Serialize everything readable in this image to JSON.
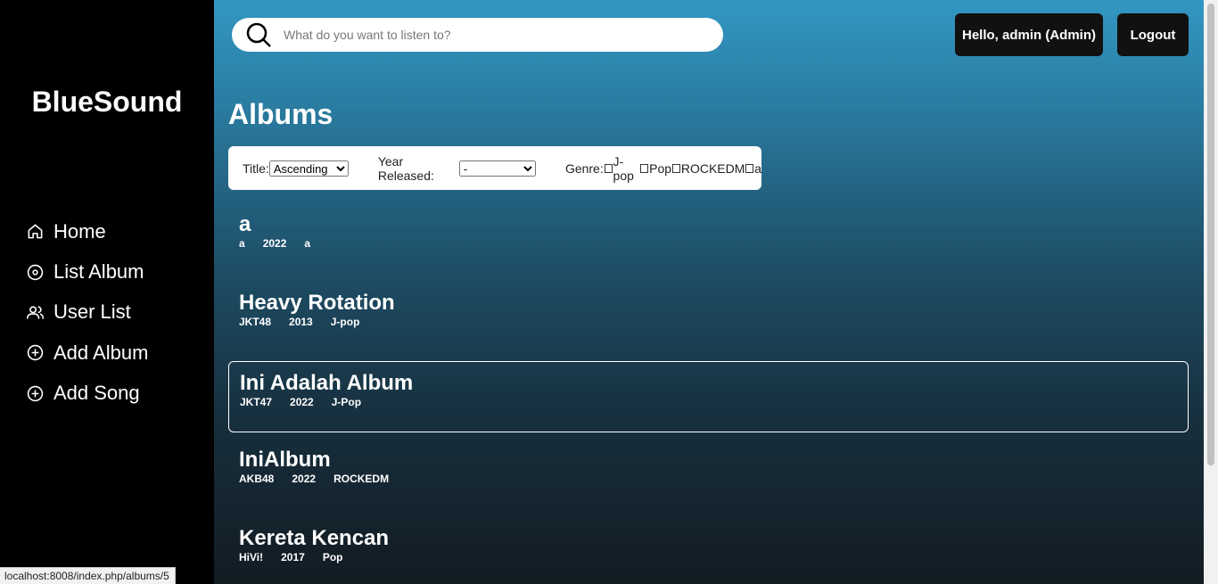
{
  "sidebar": {
    "brand": "BlueSound",
    "items": [
      {
        "label": "Home",
        "icon": "home-icon"
      },
      {
        "label": "List Album",
        "icon": "disc-icon"
      },
      {
        "label": "User List",
        "icon": "users-icon"
      },
      {
        "label": "Add Album",
        "icon": "plus-circle-icon"
      },
      {
        "label": "Add Song",
        "icon": "plus-circle-icon"
      }
    ]
  },
  "header": {
    "search_placeholder": "What do you want to listen to?",
    "greeting": "Hello, admin (Admin)",
    "logout_label": "Logout"
  },
  "main": {
    "title": "Albums",
    "filters": {
      "title_label": "Title:",
      "title_selected": "Ascending",
      "year_label": "Year Released:",
      "year_selected": "-",
      "genre_label": "Genre:",
      "genres": [
        "J-pop",
        "Pop",
        "ROCKEDM",
        "a"
      ]
    },
    "albums": [
      {
        "title": "a",
        "artist": "a",
        "year": "2022",
        "genre": "a"
      },
      {
        "title": "Heavy Rotation",
        "artist": "JKT48",
        "year": "2013",
        "genre": "J-pop"
      },
      {
        "title": "Ini Adalah Album",
        "artist": "JKT47",
        "year": "2022",
        "genre": "J-Pop"
      },
      {
        "title": "IniAlbum",
        "artist": "AKB48",
        "year": "2022",
        "genre": "ROCKEDM"
      },
      {
        "title": "Kereta Kencan",
        "artist": "HiVi!",
        "year": "2017",
        "genre": "Pop"
      }
    ]
  },
  "status_url": "localhost:8008/index.php/albums/5"
}
